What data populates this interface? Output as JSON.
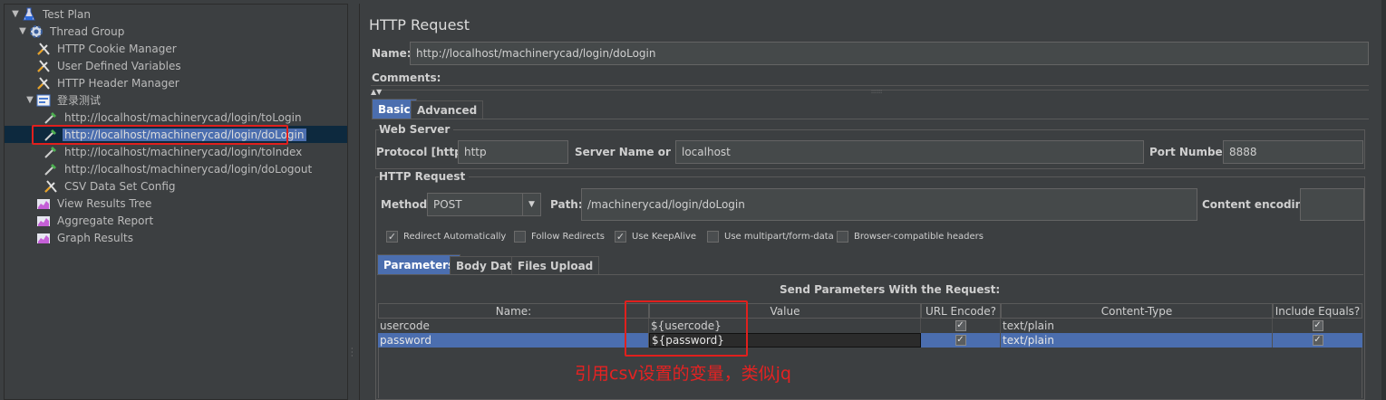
{
  "tree": {
    "items": [
      {
        "label": "Test Plan",
        "icon": "flask-icon",
        "toggle": "▼"
      },
      {
        "label": "Thread Group",
        "icon": "gear-icon",
        "toggle": "▼"
      },
      {
        "label": "HTTP Cookie Manager",
        "icon": "wrench-icon"
      },
      {
        "label": "User Defined Variables",
        "icon": "wrench-icon"
      },
      {
        "label": "HTTP Header Manager",
        "icon": "wrench-icon"
      },
      {
        "label": "登录测试",
        "icon": "controller-icon",
        "toggle": "▼"
      },
      {
        "label": "http://localhost/machinerycad/login/toLogin",
        "icon": "pipette-icon"
      },
      {
        "label": "http://localhost/machinerycad/login/doLogin",
        "icon": "pipette-icon",
        "selected": true
      },
      {
        "label": "http://localhost/machinerycad/login/toIndex",
        "icon": "pipette-icon"
      },
      {
        "label": "http://localhost/machinerycad/login/doLogout",
        "icon": "pipette-icon"
      },
      {
        "label": "CSV Data Set Config",
        "icon": "wrench-icon"
      },
      {
        "label": "View Results Tree",
        "icon": "graph-icon"
      },
      {
        "label": "Aggregate Report",
        "icon": "graph-icon"
      },
      {
        "label": "Graph Results",
        "icon": "graph-icon"
      }
    ]
  },
  "panel": {
    "title": "HTTP Request",
    "name_label": "Name:",
    "name_value": "http://localhost/machinerycad/login/doLogin",
    "comments_label": "Comments:",
    "tabs": [
      "Basic",
      "Advanced"
    ],
    "web_server": {
      "title": "Web Server",
      "protocol_label": "Protocol [http]:",
      "protocol_value": "http",
      "server_label": "Server Name or IP:",
      "server_value": "localhost",
      "port_label": "Port Number:",
      "port_value": "8888"
    },
    "http_request": {
      "title": "HTTP Request",
      "method_label": "Method:",
      "method_value": "POST",
      "path_label": "Path:",
      "path_value": "/machinerycad/login/doLogin",
      "encoding_label": "Content encoding:",
      "encoding_value": ""
    },
    "checkboxes": [
      {
        "label": "Redirect Automatically",
        "checked": true
      },
      {
        "label": "Follow Redirects",
        "checked": false
      },
      {
        "label": "Use KeepAlive",
        "checked": true
      },
      {
        "label": "Use multipart/form-data",
        "checked": false
      },
      {
        "label": "Browser-compatible headers",
        "checked": false
      }
    ],
    "sub_tabs": [
      "Parameters",
      "Body Data",
      "Files Upload"
    ],
    "params": {
      "caption": "Send Parameters With the Request:",
      "headers": [
        "Name:",
        "Value",
        "URL Encode?",
        "Content-Type",
        "Include Equals?"
      ],
      "rows": [
        {
          "name": "usercode",
          "value": "${usercode}",
          "url_encode": true,
          "content_type": "text/plain",
          "include_equals": true
        },
        {
          "name": "password",
          "value": "${password}",
          "url_encode": true,
          "content_type": "text/plain",
          "include_equals": true,
          "selected": true
        }
      ]
    }
  },
  "annotation": "引用csv设置的变量，类似jq",
  "colors": {
    "highlight": "#e0201d",
    "selection": "#4b6eaf",
    "background": "#3c3f41"
  }
}
